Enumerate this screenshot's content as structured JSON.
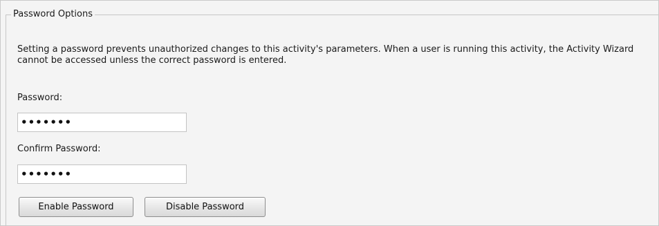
{
  "group_title": "Password Options",
  "description": "Setting a password prevents unauthorized changes to this activity's parameters. When a user is running this activity, the Activity Wizard cannot be accessed unless the correct password is entered.",
  "password": {
    "label": "Password:",
    "value": "•••••••"
  },
  "confirm_password": {
    "label": "Confirm Password:",
    "value": "•••••••"
  },
  "buttons": {
    "enable": "Enable Password",
    "disable": "Disable Password"
  }
}
